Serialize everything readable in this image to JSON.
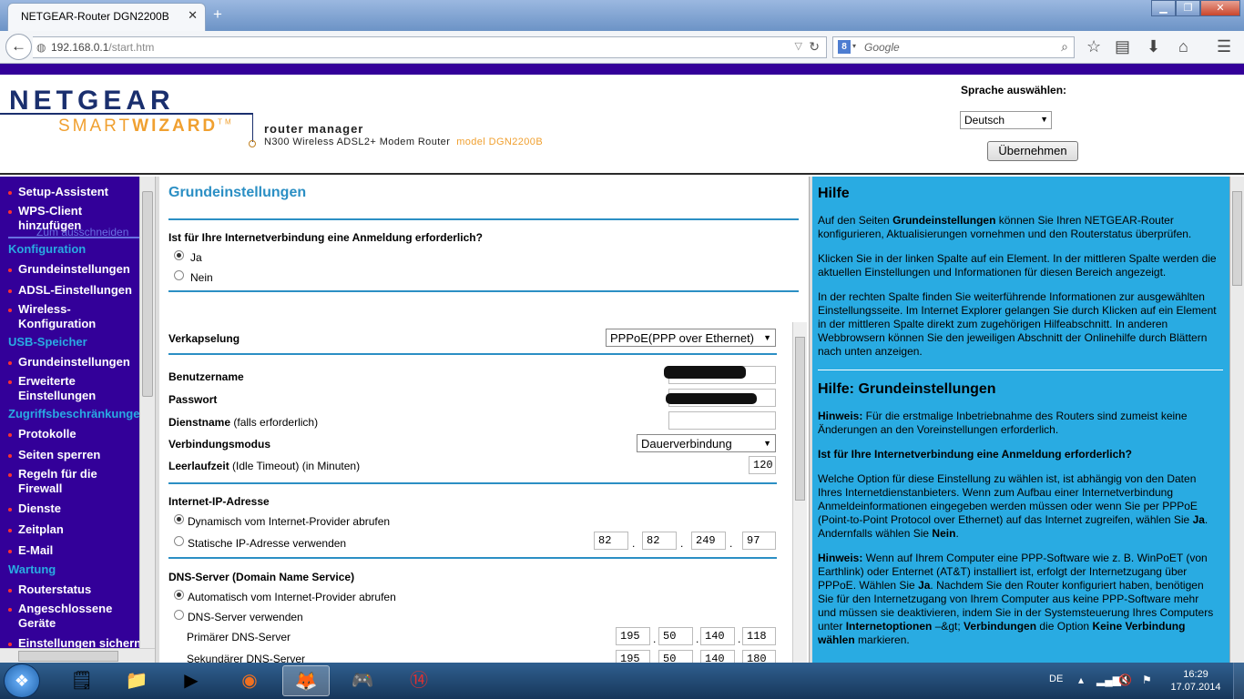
{
  "browser": {
    "tab_title": "NETGEAR-Router DGN2200B",
    "url_host": "192.168.0.1",
    "url_path": "/start.htm",
    "search_placeholder": "Google",
    "search_engine_icon": "8"
  },
  "header": {
    "logo_netgear": "NETGEAR",
    "logo_smart": "SMART",
    "logo_wizard": "WIZARD",
    "logo_tm": "TM",
    "router_manager": "router manager",
    "model_text": "N300 Wireless ADSL2+ Modem Router",
    "model_label": "model DGN2200B",
    "lang_label": "Sprache auswählen:",
    "lang_value": "Deutsch",
    "apply_label": "Übernehmen"
  },
  "menu": {
    "setup_assistant": "Setup-Assistent",
    "wps_client": "WPS-Client hinzufügen",
    "overlay_text": "Zum ausschneiden",
    "sec_config": "Konfiguration",
    "grund": "Grundeinstellungen",
    "adsl": "ADSL-Einstellungen",
    "wireless": "Wireless-Konfiguration",
    "sec_usb": "USB-Speicher",
    "usb_grund": "Grundeinstellungen",
    "usb_erw": "Erweiterte Einstellungen",
    "sec_access": "Zugriffsbeschränkungen",
    "protokolle": "Protokolle",
    "seiten": "Seiten sperren",
    "regeln": "Regeln für die Firewall",
    "dienste": "Dienste",
    "zeitplan": "Zeitplan",
    "email": "E-Mail",
    "sec_wartung": "Wartung",
    "routerstatus": "Routerstatus",
    "geraete": "Angeschlossene Geräte",
    "einst_sichern": "Einstellungen sichern"
  },
  "main": {
    "title": "Grundeinstellungen",
    "login_question": "Ist für Ihre Internetverbindung eine Anmeldung erforderlich?",
    "opt_yes": "Ja",
    "opt_no": "Nein",
    "encaps_label": "Verkapselung",
    "encaps_value": "PPPoE(PPP over Ethernet)",
    "username_label": "Benutzername",
    "password_label": "Passwort",
    "service_label": "Dienstname",
    "service_note": "(falls erforderlich)",
    "conn_mode_label": "Verbindungsmodus",
    "conn_mode_value": "Dauerverbindung",
    "idle_label": "Leerlaufzeit",
    "idle_note": "(Idle Timeout) (in Minuten)",
    "idle_value": "120",
    "ip_heading": "Internet-IP-Adresse",
    "ip_dynamic": "Dynamisch vom Internet-Provider abrufen",
    "ip_static": "Statische IP-Adresse verwenden",
    "ip": [
      "82",
      "82",
      "249",
      "97"
    ],
    "dns_heading": "DNS-Server (Domain Name Service)",
    "dns_auto": "Automatisch vom Internet-Provider abrufen",
    "dns_manual": "DNS-Server verwenden",
    "dns_primary_label": "Primärer DNS-Server",
    "dns_primary": [
      "195",
      "50",
      "140",
      "118"
    ],
    "dns_secondary_label": "Sekundärer DNS-Server",
    "dns_secondary": [
      "195",
      "50",
      "140",
      "180"
    ]
  },
  "help": {
    "title": "Hilfe",
    "p1_a": "Auf den Seiten ",
    "p1_b": "Grundeinstellungen",
    "p1_c": " können Sie Ihren NETGEAR-Router konfigurieren, Aktualisierungen vornehmen und den Routerstatus überprüfen.",
    "p2": "Klicken Sie in der linken Spalte auf ein Element. In der mittleren Spalte werden die aktuellen Einstellungen und Informationen für diesen Bereich angezeigt.",
    "p3": "In der rechten Spalte finden Sie weiterführende Informationen zur ausgewählten Einstellungsseite. Im Internet Explorer gelangen Sie durch Klicken auf ein Element in der mittleren Spalte direkt zum zugehörigen Hilfeabschnitt. In anderen Webbrowsern können Sie den jeweiligen Abschnitt der Onlinehilfe durch Blättern nach unten anzeigen.",
    "title2": "Hilfe: Grundeinstellungen",
    "note1_b": "Hinweis:",
    "note1": " Für die erstmalige Inbetriebnahme des Routers sind zumeist keine Änderungen an den Voreinstellungen erforderlich.",
    "q": "Ist für Ihre Internetverbindung eine Anmeldung erforderlich?",
    "p4_a": "Welche Option für diese Einstellung zu wählen ist, ist abhängig von den Daten Ihres Internetdienstanbieters. Wenn zum Aufbau einer Internetverbindung Anmeldeinformationen eingegeben werden müssen oder wenn Sie per PPPoE (Point-to-Point Protocol over Ethernet) auf das Internet zugreifen, wählen Sie ",
    "p4_ja": "Ja",
    "p4_b": ". Andernfalls wählen Sie ",
    "p4_nein": "Nein",
    "p4_c": ".",
    "note2_b": "Hinweis:",
    "note2_a": " Wenn auf Ihrem Computer eine PPP-Software wie z. B. WinPoET (von Earthlink) oder Enternet (AT&T) installiert ist, erfolgt der Internetzugang über PPPoE. Wählen Sie ",
    "note2_ja": "Ja",
    "note2_c": ". Nachdem Sie den Router konfiguriert haben, benötigen Sie für den Internetzugang von Ihrem Computer aus keine PPP-Software mehr und müssen sie deaktivieren, indem Sie in der Systemsteuerung Ihres Computers unter ",
    "note2_io": "Internetoptionen",
    "note2_d": " –&gt; ",
    "note2_v": "Verbindungen",
    "note2_e": " die Option ",
    "note2_kv": "Keine Verbindung wählen",
    "note2_f": " markieren."
  },
  "taskbar": {
    "lang": "DE",
    "time": "16:29",
    "date": "17.07.2014"
  }
}
